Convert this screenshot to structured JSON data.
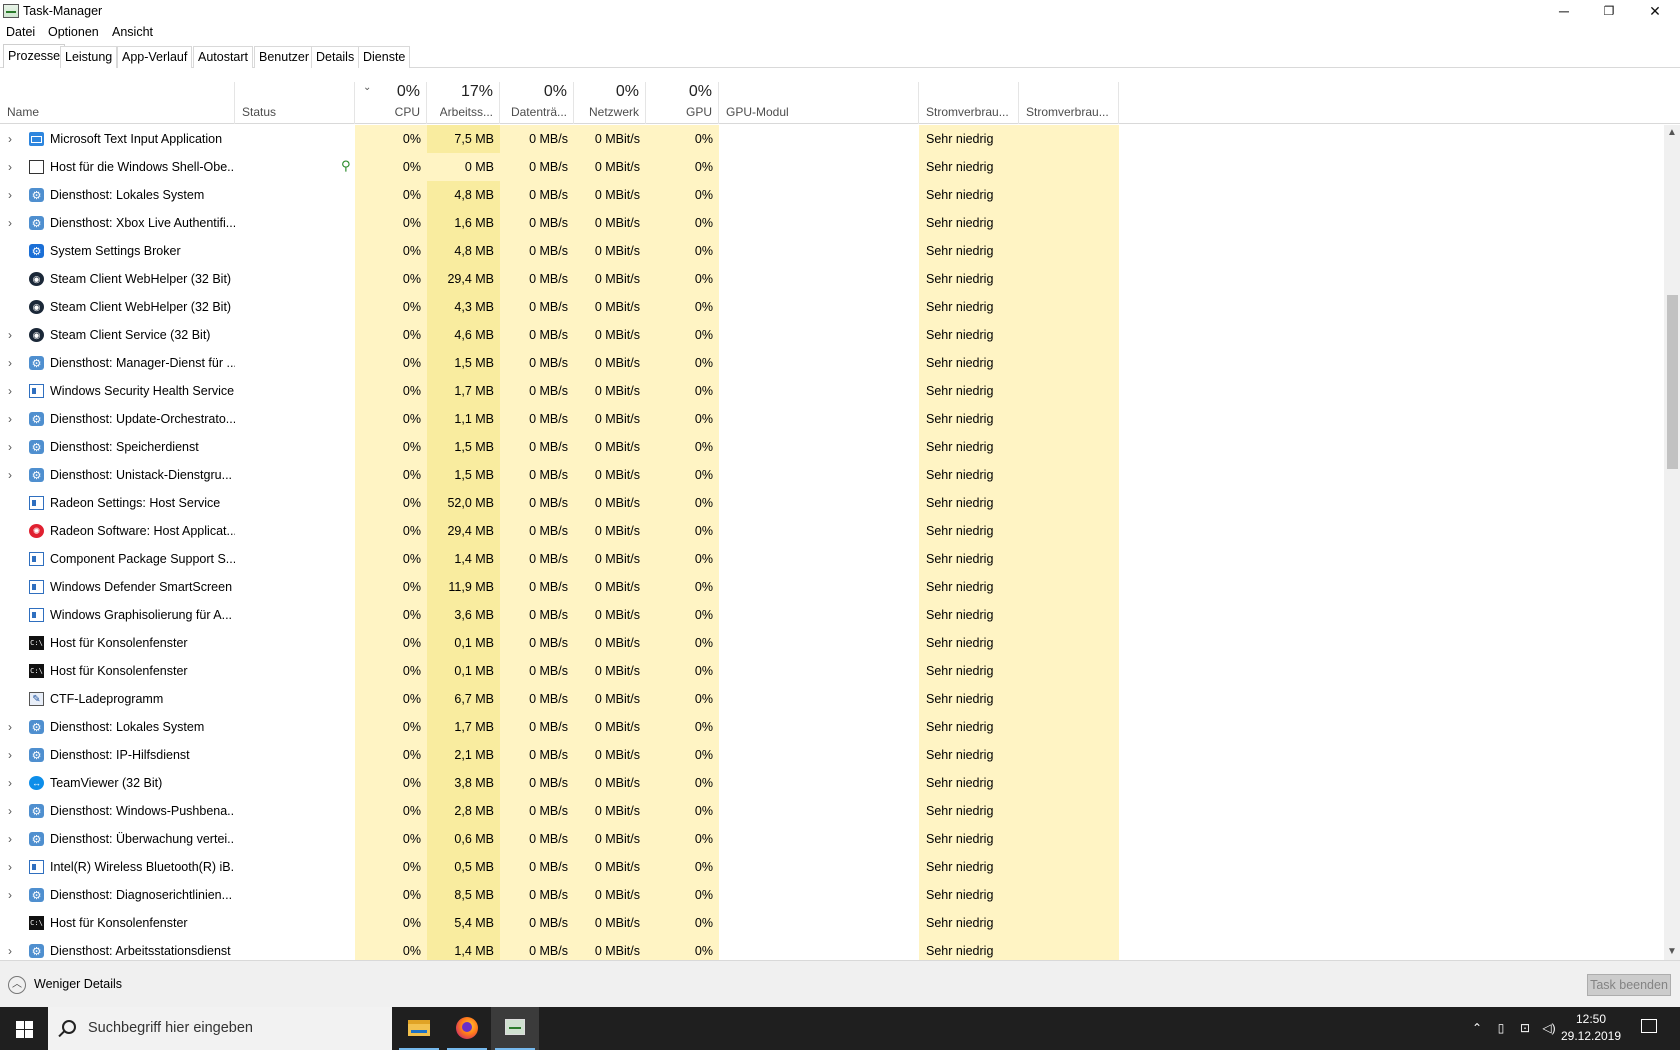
{
  "window": {
    "title": "Task-Manager",
    "minimize": "─",
    "restore": "❐",
    "close": "✕"
  },
  "menu": [
    "Datei",
    "Optionen",
    "Ansicht"
  ],
  "tabs": [
    "Prozesse",
    "Leistung",
    "App-Verlauf",
    "Autostart",
    "Benutzer",
    "Details",
    "Dienste"
  ],
  "header": {
    "name": "Name",
    "status": "Status",
    "cpu_pct": "0%",
    "cpu": "CPU",
    "mem_pct": "17%",
    "mem": "Arbeitss...",
    "disk_pct": "0%",
    "disk": "Datenträ...",
    "net_pct": "0%",
    "net": "Netzwerk",
    "gpu_pct": "0%",
    "gpu": "GPU",
    "gpu_engine": "GPU-Modul",
    "power": "Stromverbrau...",
    "power_trend": "Stromverbrau...",
    "sort_indicator": "⌄"
  },
  "processes": [
    {
      "expand": true,
      "icon": "keyboard",
      "name": "Microsoft Text Input Application",
      "cpu": "0%",
      "mem": "7,5 MB",
      "disk": "0 MB/s",
      "net": "0 MBit/s",
      "gpu": "0%",
      "power": "Sehr niedrig"
    },
    {
      "expand": true,
      "icon": "window-dark",
      "name": "Host für die Windows Shell-Obe...",
      "cpu": "0%",
      "mem": "0 MB",
      "disk": "0 MB/s",
      "net": "0 MBit/s",
      "gpu": "0%",
      "power": "Sehr niedrig",
      "leaf": true
    },
    {
      "expand": true,
      "icon": "gear",
      "name": "Diensthost: Lokales System",
      "cpu": "0%",
      "mem": "4,8 MB",
      "disk": "0 MB/s",
      "net": "0 MBit/s",
      "gpu": "0%",
      "power": "Sehr niedrig"
    },
    {
      "expand": true,
      "icon": "gear",
      "name": "Diensthost: Xbox Live Authentifi...",
      "cpu": "0%",
      "mem": "1,6 MB",
      "disk": "0 MB/s",
      "net": "0 MBit/s",
      "gpu": "0%",
      "power": "Sehr niedrig"
    },
    {
      "expand": false,
      "icon": "gear-blue",
      "name": "System Settings Broker",
      "cpu": "0%",
      "mem": "4,8 MB",
      "disk": "0 MB/s",
      "net": "0 MBit/s",
      "gpu": "0%",
      "power": "Sehr niedrig"
    },
    {
      "expand": false,
      "icon": "steam",
      "name": "Steam Client WebHelper (32 Bit)",
      "cpu": "0%",
      "mem": "29,4 MB",
      "disk": "0 MB/s",
      "net": "0 MBit/s",
      "gpu": "0%",
      "power": "Sehr niedrig"
    },
    {
      "expand": false,
      "icon": "steam",
      "name": "Steam Client WebHelper (32 Bit)",
      "cpu": "0%",
      "mem": "4,3 MB",
      "disk": "0 MB/s",
      "net": "0 MBit/s",
      "gpu": "0%",
      "power": "Sehr niedrig"
    },
    {
      "expand": true,
      "icon": "steam",
      "name": "Steam Client Service (32 Bit)",
      "cpu": "0%",
      "mem": "4,6 MB",
      "disk": "0 MB/s",
      "net": "0 MBit/s",
      "gpu": "0%",
      "power": "Sehr niedrig"
    },
    {
      "expand": true,
      "icon": "gear",
      "name": "Diensthost: Manager-Dienst für ...",
      "cpu": "0%",
      "mem": "1,5 MB",
      "disk": "0 MB/s",
      "net": "0 MBit/s",
      "gpu": "0%",
      "power": "Sehr niedrig"
    },
    {
      "expand": true,
      "icon": "window",
      "name": "Windows Security Health Service",
      "cpu": "0%",
      "mem": "1,7 MB",
      "disk": "0 MB/s",
      "net": "0 MBit/s",
      "gpu": "0%",
      "power": "Sehr niedrig"
    },
    {
      "expand": true,
      "icon": "gear",
      "name": "Diensthost: Update-Orchestrato...",
      "cpu": "0%",
      "mem": "1,1 MB",
      "disk": "0 MB/s",
      "net": "0 MBit/s",
      "gpu": "0%",
      "power": "Sehr niedrig"
    },
    {
      "expand": true,
      "icon": "gear",
      "name": "Diensthost: Speicherdienst",
      "cpu": "0%",
      "mem": "1,5 MB",
      "disk": "0 MB/s",
      "net": "0 MBit/s",
      "gpu": "0%",
      "power": "Sehr niedrig"
    },
    {
      "expand": true,
      "icon": "gear",
      "name": "Diensthost: Unistack-Dienstgru...",
      "cpu": "0%",
      "mem": "1,5 MB",
      "disk": "0 MB/s",
      "net": "0 MBit/s",
      "gpu": "0%",
      "power": "Sehr niedrig"
    },
    {
      "expand": false,
      "icon": "window",
      "name": "Radeon Settings: Host Service",
      "cpu": "0%",
      "mem": "52,0 MB",
      "disk": "0 MB/s",
      "net": "0 MBit/s",
      "gpu": "0%",
      "power": "Sehr niedrig"
    },
    {
      "expand": false,
      "icon": "radeon",
      "name": "Radeon Software: Host Applicat...",
      "cpu": "0%",
      "mem": "29,4 MB",
      "disk": "0 MB/s",
      "net": "0 MBit/s",
      "gpu": "0%",
      "power": "Sehr niedrig"
    },
    {
      "expand": false,
      "icon": "window",
      "name": "Component Package Support S...",
      "cpu": "0%",
      "mem": "1,4 MB",
      "disk": "0 MB/s",
      "net": "0 MBit/s",
      "gpu": "0%",
      "power": "Sehr niedrig"
    },
    {
      "expand": false,
      "icon": "window",
      "name": "Windows Defender SmartScreen",
      "cpu": "0%",
      "mem": "11,9 MB",
      "disk": "0 MB/s",
      "net": "0 MBit/s",
      "gpu": "0%",
      "power": "Sehr niedrig"
    },
    {
      "expand": false,
      "icon": "window",
      "name": "Windows Graphisolierung für A...",
      "cpu": "0%",
      "mem": "3,6 MB",
      "disk": "0 MB/s",
      "net": "0 MBit/s",
      "gpu": "0%",
      "power": "Sehr niedrig"
    },
    {
      "expand": false,
      "icon": "console",
      "name": "Host für Konsolenfenster",
      "cpu": "0%",
      "mem": "0,1 MB",
      "disk": "0 MB/s",
      "net": "0 MBit/s",
      "gpu": "0%",
      "power": "Sehr niedrig"
    },
    {
      "expand": false,
      "icon": "console",
      "name": "Host für Konsolenfenster",
      "cpu": "0%",
      "mem": "0,1 MB",
      "disk": "0 MB/s",
      "net": "0 MBit/s",
      "gpu": "0%",
      "power": "Sehr niedrig"
    },
    {
      "expand": false,
      "icon": "ctf",
      "name": "CTF-Ladeprogramm",
      "cpu": "0%",
      "mem": "6,7 MB",
      "disk": "0 MB/s",
      "net": "0 MBit/s",
      "gpu": "0%",
      "power": "Sehr niedrig"
    },
    {
      "expand": true,
      "icon": "gear",
      "name": "Diensthost: Lokales System",
      "cpu": "0%",
      "mem": "1,7 MB",
      "disk": "0 MB/s",
      "net": "0 MBit/s",
      "gpu": "0%",
      "power": "Sehr niedrig"
    },
    {
      "expand": true,
      "icon": "gear",
      "name": "Diensthost: IP-Hilfsdienst",
      "cpu": "0%",
      "mem": "2,1 MB",
      "disk": "0 MB/s",
      "net": "0 MBit/s",
      "gpu": "0%",
      "power": "Sehr niedrig"
    },
    {
      "expand": true,
      "icon": "teamviewer",
      "name": "TeamViewer (32 Bit)",
      "cpu": "0%",
      "mem": "3,8 MB",
      "disk": "0 MB/s",
      "net": "0 MBit/s",
      "gpu": "0%",
      "power": "Sehr niedrig"
    },
    {
      "expand": true,
      "icon": "gear",
      "name": "Diensthost: Windows-Pushbena...",
      "cpu": "0%",
      "mem": "2,8 MB",
      "disk": "0 MB/s",
      "net": "0 MBit/s",
      "gpu": "0%",
      "power": "Sehr niedrig"
    },
    {
      "expand": true,
      "icon": "gear",
      "name": "Diensthost: Überwachung vertei...",
      "cpu": "0%",
      "mem": "0,6 MB",
      "disk": "0 MB/s",
      "net": "0 MBit/s",
      "gpu": "0%",
      "power": "Sehr niedrig"
    },
    {
      "expand": true,
      "icon": "window",
      "name": "Intel(R) Wireless Bluetooth(R) iB...",
      "cpu": "0%",
      "mem": "0,5 MB",
      "disk": "0 MB/s",
      "net": "0 MBit/s",
      "gpu": "0%",
      "power": "Sehr niedrig"
    },
    {
      "expand": true,
      "icon": "gear",
      "name": "Diensthost: Diagnoserichtlinien...",
      "cpu": "0%",
      "mem": "8,5 MB",
      "disk": "0 MB/s",
      "net": "0 MBit/s",
      "gpu": "0%",
      "power": "Sehr niedrig"
    },
    {
      "expand": false,
      "icon": "console",
      "name": "Host für Konsolenfenster",
      "cpu": "0%",
      "mem": "5,4 MB",
      "disk": "0 MB/s",
      "net": "0 MBit/s",
      "gpu": "0%",
      "power": "Sehr niedrig"
    },
    {
      "expand": true,
      "icon": "gear",
      "name": "Diensthost: Arbeitsstationsdienst",
      "cpu": "0%",
      "mem": "1,4 MB",
      "disk": "0 MB/s",
      "net": "0 MBit/s",
      "gpu": "0%",
      "power": "Sehr niedrig"
    }
  ],
  "footer": {
    "fewer_details": "Weniger Details",
    "end_task": "Task beenden"
  },
  "taskbar": {
    "search_placeholder": "Suchbegriff hier eingeben",
    "time": "12:50",
    "date": "29.12.2019"
  }
}
